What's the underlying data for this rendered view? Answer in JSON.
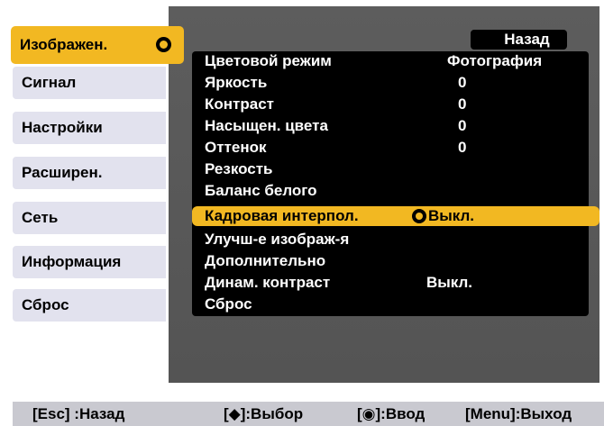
{
  "sidebar": {
    "items": [
      {
        "label": "Изображен.",
        "active": true
      },
      {
        "label": "Сигнал"
      },
      {
        "label": "Настройки"
      },
      {
        "label": "Расширен."
      },
      {
        "label": "Сеть"
      },
      {
        "label": "Информация"
      },
      {
        "label": "Сброс"
      }
    ]
  },
  "header": {
    "back_label": "Назад"
  },
  "menu": {
    "rows": [
      {
        "label": "Цветовой режим",
        "value": "Фотография"
      },
      {
        "label": "Яркость",
        "value": "0"
      },
      {
        "label": "Контраст",
        "value": "0"
      },
      {
        "label": "Насыщен. цвета",
        "value": "0"
      },
      {
        "label": "Оттенок",
        "value": "0"
      },
      {
        "label": "Резкость",
        "value": ""
      },
      {
        "label": "Баланс белого",
        "value": ""
      },
      {
        "label": "Кадровая интерпол.",
        "value": "Выкл.",
        "selected": true
      },
      {
        "label": "Улучш-е изображ-я",
        "value": ""
      },
      {
        "label": "Дополнительно",
        "value": ""
      },
      {
        "label": "Динам. контраст",
        "value": "Выкл."
      },
      {
        "label": "Сброс",
        "value": ""
      }
    ]
  },
  "help": {
    "esc": "[Esc] :Назад",
    "select": "[◆]:Выбор",
    "enter": "[◉]:Ввод",
    "menu": "[Menu]:Выход"
  },
  "colors": {
    "accent": "#f2b822",
    "panel": "#5b5b5b",
    "sidebar": "#e2e2ee",
    "helpbar": "#c9c9d0"
  },
  "icons": [
    "enter-icon",
    "updown-icon"
  ]
}
